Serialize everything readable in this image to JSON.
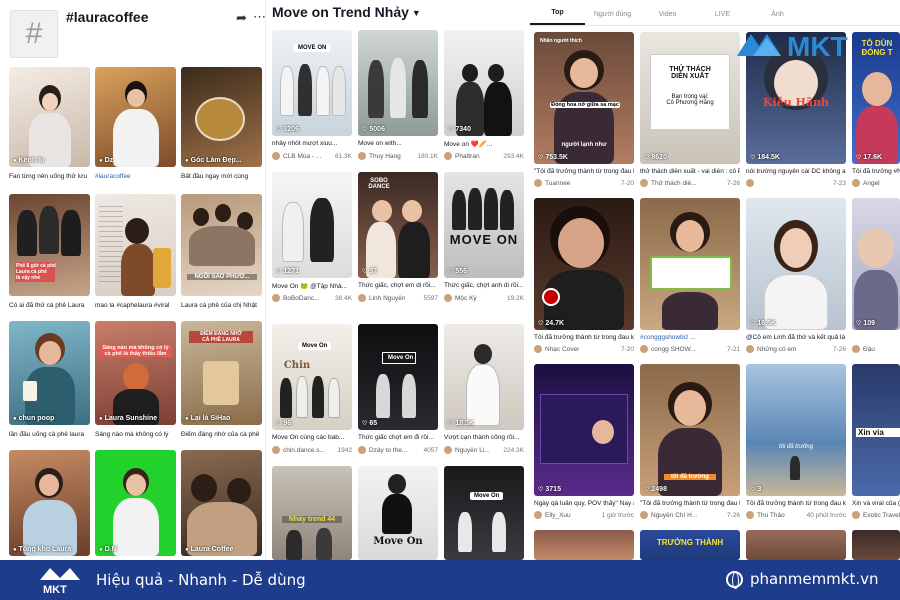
{
  "panel1": {
    "title": "#lauracoffee",
    "cards": [
      {
        "label": "Kênh lu",
        "caption": "Fan từng nên uống thử lưu"
      },
      {
        "label": "Dz",
        "caption": "#lauracoffee"
      },
      {
        "label": "Góc Làm Đẹp...",
        "caption": "Bất đầu ngay mới cùng"
      },
      {
        "label": "",
        "caption": "Có ai đã thử cà phê Laura"
      },
      {
        "label": "",
        "caption": "mao la #caphelaura #viral"
      },
      {
        "label": "",
        "caption": "Laura cà phê của chị Nhật"
      },
      {
        "label": "chun poop",
        "caption": "lần đầu uống cà phê laura"
      },
      {
        "label": "Laura Sunshine",
        "caption": "Sáng nào mà không có lý"
      },
      {
        "label": "Lại là SiHao",
        "caption": "Điểm đáng nhớ của cà phê"
      },
      {
        "label": "Tổng kho Laura",
        "caption": ""
      },
      {
        "label": "D.N",
        "caption": ""
      },
      {
        "label": "Laura Coffee",
        "caption": ""
      }
    ],
    "overlays": {
      "card4": "Phê 8 giờ cà phê\nLaura cà phê\nlà vậy nhé",
      "card6": "NGỒI SAO PHƯƠ...",
      "card8": "Sáng nào mà không có lý\ncà phê là thấy thiếu lắm",
      "card9": "ĐIỂM ĐÁNG NHỚ\nCÀ PHÊ LAURA"
    }
  },
  "panel2": {
    "title": "Move on Trend Nhảy",
    "cards": [
      {
        "likes": "3206",
        "caption": "nhảy nhót mượt xiuu...",
        "user": "CLB Múa - ...",
        "count": "61.3K"
      },
      {
        "likes": "5006",
        "caption": "Move on with...",
        "user": "Thuy Hang",
        "count": "180.1K"
      },
      {
        "likes": "7340",
        "caption": "Move on ❤️🥖...",
        "user": "Phattran",
        "count": "293.4K"
      },
      {
        "likes": "1271",
        "caption": "Move On 🐸 @Tập Nhả...",
        "user": "BoBoDanc...",
        "count": "38.4K"
      },
      {
        "likes": "37",
        "caption": "Thức giấc, chợt em di rồi...",
        "user": "Linh Nguyễn",
        "count": "5597"
      },
      {
        "likes": "556",
        "caption": "Thức giấc, chợt anh di rồi...",
        "user": "Mộc Kỳ",
        "count": "19.2K"
      },
      {
        "likes": "96",
        "caption": "Move On cùng các bab...",
        "user": "chin.dance.s...",
        "count": "1942"
      },
      {
        "likes": "65",
        "caption": "Thức giấc chợt em đi rồi...",
        "user": "Dzây to the...",
        "count": "4057"
      },
      {
        "likes": "18.3K",
        "caption": "Vượt cạn thành công rồi...",
        "user": "Nguyễn Li...",
        "count": "224.3K"
      },
      {
        "likes": "",
        "caption": "",
        "user": "",
        "count": ""
      },
      {
        "likes": "",
        "caption": "",
        "user": "",
        "count": ""
      },
      {
        "likes": "",
        "caption": "",
        "user": "",
        "count": ""
      }
    ],
    "overlays": {
      "move_on": "MOVE ON",
      "sobo": "SOBO\nDANCE",
      "big_move_on": "MOVE ON",
      "chin": "Chin",
      "move_on_small": "Move On",
      "nhay_trend": "Nhảy trend 44",
      "move_on_script": "Move On"
    }
  },
  "panel3": {
    "tabs": [
      "Top",
      "Người dùng",
      "Video",
      "LIVE",
      "Ảnh"
    ],
    "cards": [
      {
        "likes": "753.5K",
        "caption": "\"Tôi đã trưởng thành từ trong đau k...",
        "user": "Tuannee",
        "date": "7-20"
      },
      {
        "likes": "8620",
        "caption": "thử thách diễn xuất - vai diễn : cô P...",
        "user": "Thử thách diễ...",
        "date": "7-26"
      },
      {
        "likes": "184.5K",
        "caption": "nói trường nguyên cái DC không ai k...",
        "user": "",
        "date": "7-23"
      },
      {
        "likes": "17.6K",
        "caption": "Tôi đã trưởng #Ng",
        "user": "Angel",
        "date": ""
      },
      {
        "likes": "24.7K",
        "caption": "Tôi đã trưởng thành từ trong đau k...",
        "user": "Nhạc Cover",
        "date": "7-20"
      },
      {
        "likes": "",
        "caption": "#congggshowbiz ...",
        "user": "congg SHOW...",
        "date": "7-21"
      },
      {
        "likes": "16.5K",
        "caption": "@Cô em Linh đã thử và kết quả là ...",
        "user": "Những có em",
        "date": "7-26"
      },
      {
        "likes": "109",
        "caption": "",
        "user": "Đậu",
        "date": ""
      },
      {
        "likes": "3715",
        "caption": "Ngày qà luân quy, POV thấy\" Nay á...",
        "user": "Elly_Xuu",
        "date": "1 giờ trước"
      },
      {
        "likes": "2498",
        "caption": "\"Tôi đã trưởng thành từ trong đau k...",
        "user": "Nguyễn Chí H...",
        "date": "7-26"
      },
      {
        "likes": "3",
        "caption": "Tôi đã trưởng thành từ trong đau k...",
        "user": "Thu Thảo",
        "date": "40 phút trước"
      },
      {
        "likes": "",
        "caption": "Xin và viral của (Exotic...",
        "user": "Exotic Travel",
        "date": ""
      }
    ],
    "overlays": {
      "nhan_nguoi_thich": "Nhãn người thích",
      "dong_hoa": "Đồng hoa nở giữa sa mạc",
      "nguoi_lanh_nhu": "người lạnh như",
      "thu_thach": "THỬ THÁCH\nDIỄN XUẤT",
      "ban_trong_vai": "Bạn trong vai:\nCô Phương Hằng",
      "kieu_hanh": "Kiêu Hãnh",
      "to_dun": "TÔ DÙN\nĐÓNG T",
      "toi_da_truong_1": "tôi đã trưởng",
      "toi_da_truong_2": "tôi đã trưởng",
      "truong_thanh": "TRƯỞNG THÀNH",
      "xin_via": "Xin via"
    }
  },
  "logo": {
    "text": "MKT"
  },
  "bottom_bar": {
    "logo_text": "MKT",
    "tagline": "Hiệu quả - Nhanh - Dễ dùng",
    "url": "phanmemmkt.vn"
  }
}
